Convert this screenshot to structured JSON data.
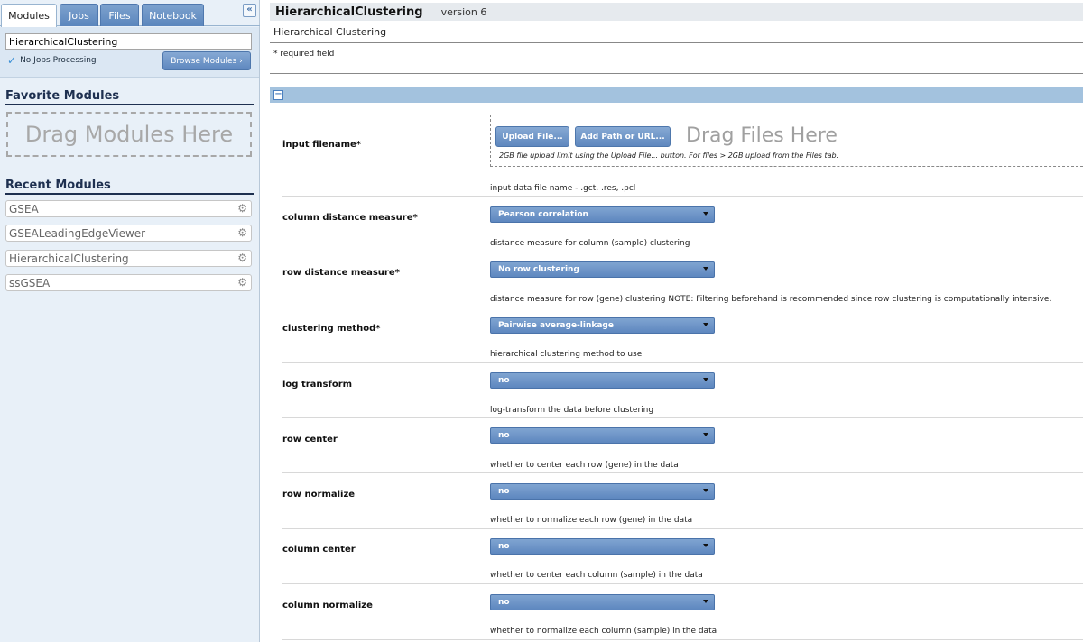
{
  "tabs": [
    {
      "label": "Modules"
    },
    {
      "label": "Jobs"
    },
    {
      "label": "Files"
    },
    {
      "label": "Notebook"
    }
  ],
  "collapse_icon": "collapse-double-left-icon",
  "search": {
    "value": "hierarchicalClustering"
  },
  "status": {
    "text": "No Jobs Processing"
  },
  "browse_button": "Browse Modules ›",
  "favorites": {
    "heading": "Favorite Modules",
    "dropzone": "Drag Modules Here"
  },
  "recent": {
    "heading": "Recent Modules",
    "items": [
      {
        "label": "GSEA"
      },
      {
        "label": "GSEALeadingEdgeViewer"
      },
      {
        "label": "HierarchicalClustering"
      },
      {
        "label": "ssGSEA"
      }
    ]
  },
  "module": {
    "name": "HierarchicalClustering",
    "version": "version 6",
    "description": "Hierarchical Clustering",
    "required_note": "* required field"
  },
  "file_param": {
    "label": "input filename*",
    "upload_button": "Upload File...",
    "add_path_button": "Add Path or URL...",
    "drag_text": "Drag Files Here",
    "hint": "2GB file upload limit using the Upload File... button. For files > 2GB upload from the Files tab.",
    "description": "input data file name - .gct, .res, .pcl"
  },
  "params": [
    {
      "label": "column distance measure*",
      "value": "Pearson correlation",
      "description": "distance measure for column (sample) clustering"
    },
    {
      "label": "row distance measure*",
      "value": "No row clustering",
      "description": "distance measure for row (gene) clustering NOTE: Filtering beforehand is recommended since row clustering is computationally intensive."
    },
    {
      "label": "clustering method*",
      "value": "Pairwise average-linkage",
      "description": "hierarchical clustering method to use"
    },
    {
      "label": "log transform",
      "value": "no",
      "description": "log-transform the data before clustering"
    },
    {
      "label": "row center",
      "value": "no",
      "description": "whether to center each row (gene) in the data"
    },
    {
      "label": "row normalize",
      "value": "no",
      "description": "whether to normalize each row (gene) in the data"
    },
    {
      "label": "column center",
      "value": "no",
      "description": "whether to center each column (sample) in the data"
    },
    {
      "label": "column normalize",
      "value": "no",
      "description": "whether to normalize each column (sample) in the data"
    }
  ]
}
